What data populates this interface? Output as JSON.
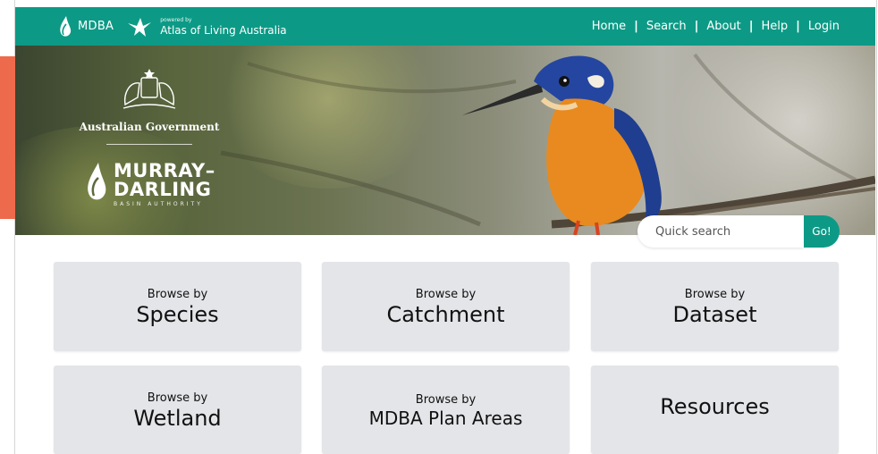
{
  "nav": {
    "brand": "MDBA",
    "ala_powered_by": "powered by",
    "ala_name": "Atlas of Living Australia",
    "links": [
      "Home",
      "Search",
      "About",
      "Help",
      "Login"
    ],
    "separator": "|",
    "color": "#0c9a86"
  },
  "hero": {
    "government_name": "Australian Government",
    "mdba_line1": "MURRAY–",
    "mdba_line2": "DARLING",
    "mdba_line3": "BASIN AUTHORITY"
  },
  "search": {
    "placeholder": "Quick search",
    "button_label": "Go!"
  },
  "tiles": [
    {
      "small": "Browse by",
      "big": "Species"
    },
    {
      "small": "Browse by",
      "big": "Catchment"
    },
    {
      "small": "Browse by",
      "big": "Dataset"
    },
    {
      "small": "Browse by",
      "big": "Wetland"
    },
    {
      "small": "Browse by",
      "big": "MDBA Plan Areas"
    },
    {
      "small": "",
      "big": "Resources"
    }
  ],
  "colors": {
    "accent": "#0c9a86",
    "side_tab": "#ee6a4c",
    "tile_bg": "#e3e5e8"
  }
}
